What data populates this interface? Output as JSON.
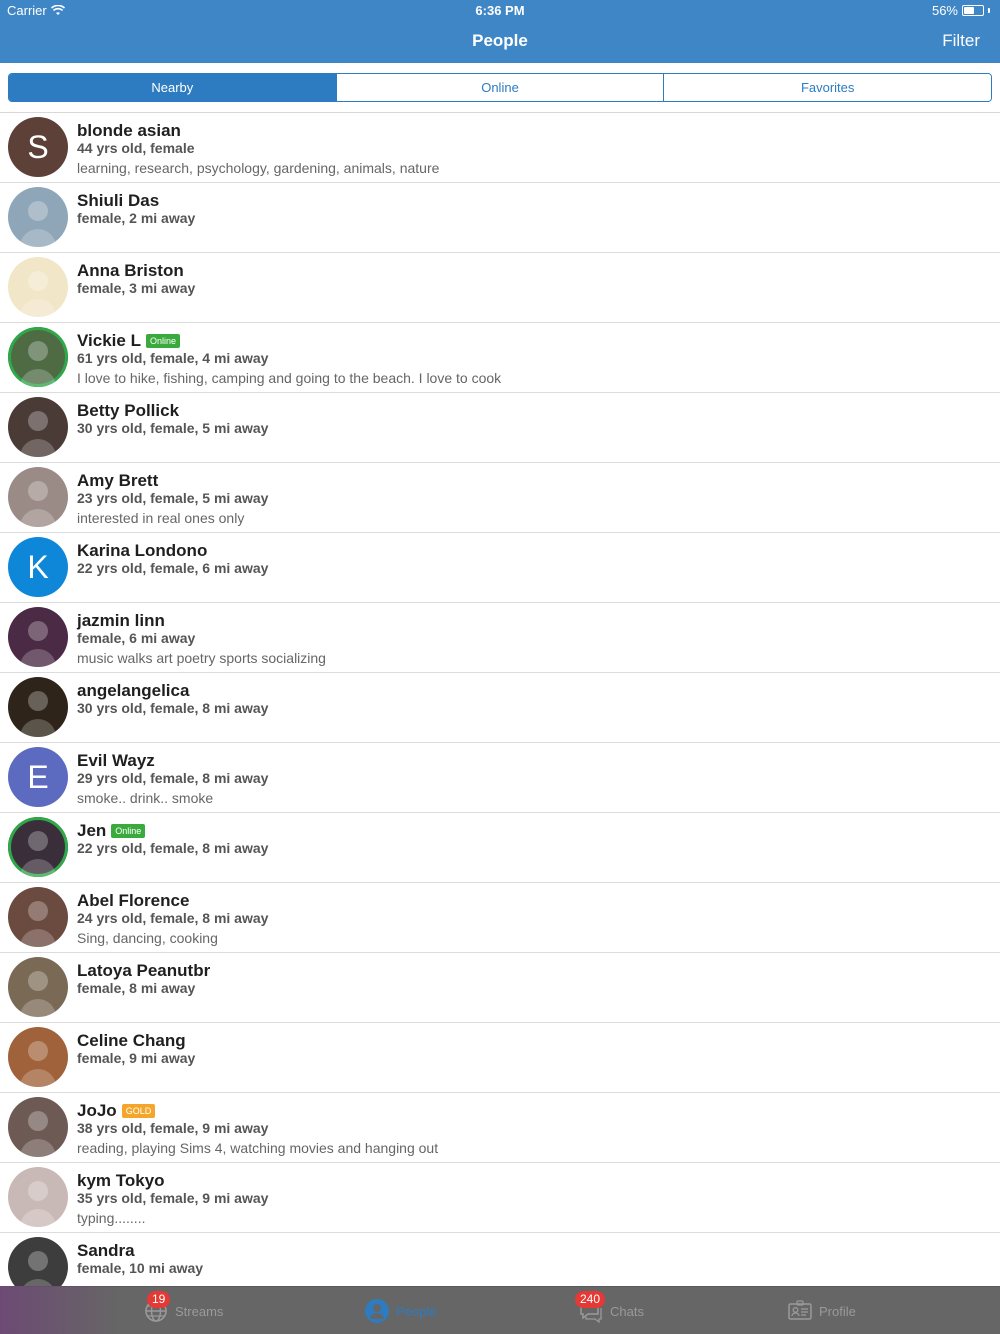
{
  "status_bar": {
    "carrier": "Carrier",
    "time": "6:36 PM",
    "battery": "56%",
    "battery_level": 0.56
  },
  "nav": {
    "title": "People",
    "filter_label": "Filter"
  },
  "segments": [
    {
      "label": "Nearby",
      "active": true
    },
    {
      "label": "Online",
      "active": false
    },
    {
      "label": "Favorites",
      "active": false
    }
  ],
  "people": [
    {
      "name": "blonde asian",
      "details": "44 yrs old, female",
      "bio": "learning, research, psychology, gardening, animals, nature",
      "initial": "S",
      "avatar_color": "#5d4037",
      "badge": ""
    },
    {
      "name": "Shiuli Das",
      "details": "female, 2 mi away",
      "bio": "",
      "initial": "",
      "avatar_color": "#8fa6b8",
      "badge": ""
    },
    {
      "name": "Anna Briston",
      "details": "female, 3 mi away",
      "bio": "",
      "initial": "",
      "avatar_color": "#f2e6c8",
      "badge": ""
    },
    {
      "name": "Vickie L",
      "details": "61 yrs old, female, 4 mi away",
      "bio": "I love to hike, fishing, camping and going to the beach. I love to cook",
      "initial": "",
      "avatar_color": "#4e6b44",
      "badge": "Online"
    },
    {
      "name": "Betty Pollick",
      "details": "30 yrs old, female, 5 mi away",
      "bio": "",
      "initial": "",
      "avatar_color": "#4a3b36",
      "badge": ""
    },
    {
      "name": "Amy Brett",
      "details": "23 yrs old, female, 5 mi away",
      "bio": "interested in real ones only",
      "initial": "",
      "avatar_color": "#9b8b87",
      "badge": ""
    },
    {
      "name": "Karina Londono",
      "details": "22 yrs old, female, 6 mi away",
      "bio": "",
      "initial": "K",
      "avatar_color": "#0f87d8",
      "badge": ""
    },
    {
      "name": "jazmin linn",
      "details": "female, 6 mi away",
      "bio": "music walks art poetry sports socializing",
      "initial": "",
      "avatar_color": "#4b2a45",
      "badge": ""
    },
    {
      "name": "angelangelica",
      "details": "30 yrs old, female, 8 mi away",
      "bio": "",
      "initial": "",
      "avatar_color": "#2e2419",
      "badge": ""
    },
    {
      "name": "Evil Wayz",
      "details": "29 yrs old, female, 8 mi away",
      "bio": "smoke.. drink.. smoke",
      "initial": "E",
      "avatar_color": "#5c6bc0",
      "badge": ""
    },
    {
      "name": "Jen",
      "details": "22 yrs old, female, 8 mi away",
      "bio": "",
      "initial": "",
      "avatar_color": "#3a2e3a",
      "badge": "Online"
    },
    {
      "name": "Abel Florence",
      "details": "24 yrs old, female, 8 mi away",
      "bio": "Sing, dancing, cooking",
      "initial": "",
      "avatar_color": "#6b4a3f",
      "badge": ""
    },
    {
      "name": "Latoya Peanutbr",
      "details": "female, 8 mi away",
      "bio": "",
      "initial": "",
      "avatar_color": "#7a6a55",
      "badge": ""
    },
    {
      "name": "Celine Chang",
      "details": "female, 9 mi away",
      "bio": "",
      "initial": "",
      "avatar_color": "#a0623a",
      "badge": ""
    },
    {
      "name": "JoJo",
      "details": "38 yrs old, female, 9 mi away",
      "bio": "reading, playing Sims 4, watching movies and hanging out",
      "initial": "",
      "avatar_color": "#6e5a55",
      "badge": "GOLD"
    },
    {
      "name": "kym Tokyo",
      "details": "35 yrs old, female, 9 mi away",
      "bio": "typing........",
      "initial": "",
      "avatar_color": "#c9b9b6",
      "badge": ""
    },
    {
      "name": "Sandra",
      "details": "female, 10 mi away",
      "bio": "",
      "initial": "",
      "avatar_color": "#3d3d3d",
      "badge": ""
    }
  ],
  "tabbar": {
    "streams": {
      "label": "Streams",
      "badge": "19"
    },
    "people": {
      "label": "People"
    },
    "chats": {
      "label": "Chats",
      "badge": "240"
    },
    "profile": {
      "label": "Profile"
    }
  },
  "colors": {
    "brand": "#3f86c6",
    "accent": "#2d7cc1",
    "online": "#3aaa3d",
    "gold": "#f4a62a"
  }
}
